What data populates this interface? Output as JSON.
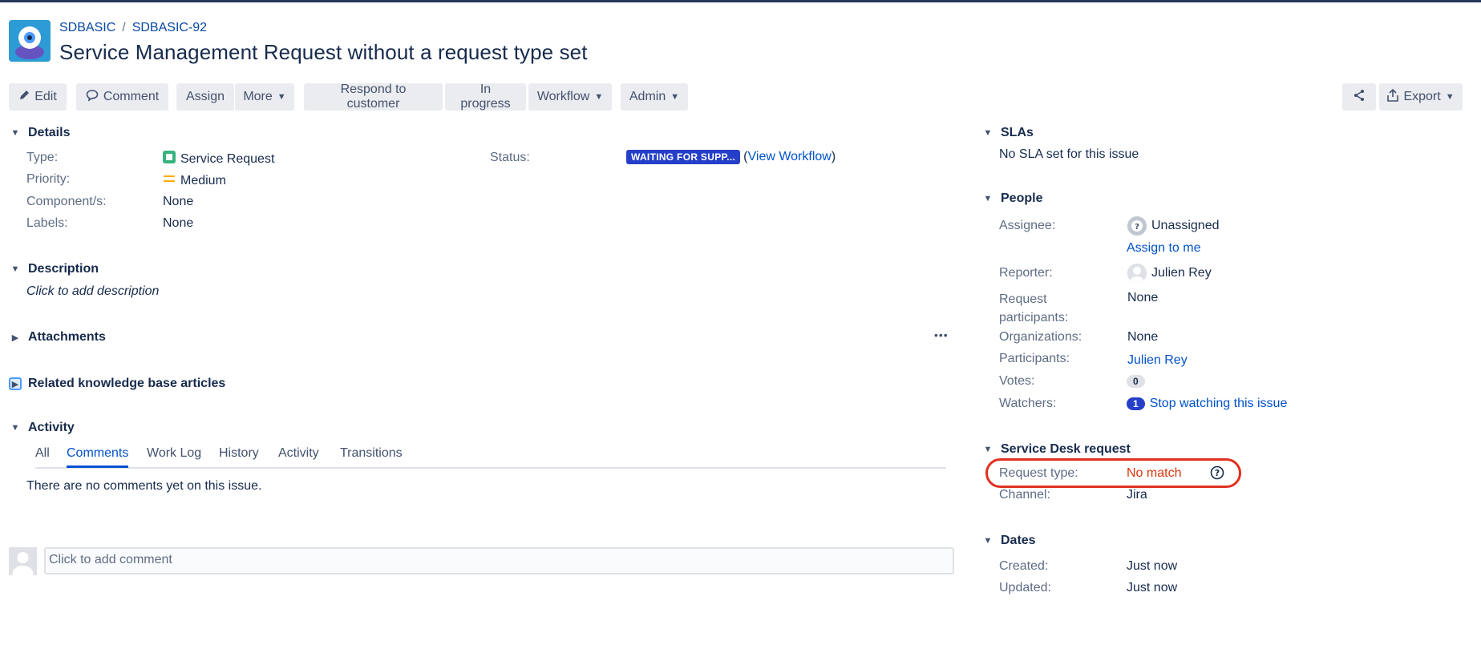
{
  "breadcrumb": {
    "project": "SDBASIC",
    "separator": "/",
    "issue_key": "SDBASIC-92"
  },
  "issue": {
    "title": "Service Management Request without a request type set"
  },
  "toolbar": {
    "edit": "Edit",
    "comment": "Comment",
    "assign": "Assign",
    "more": "More",
    "respond": "Respond to customer",
    "in_progress": "In progress",
    "workflow": "Workflow",
    "admin": "Admin",
    "export": "Export"
  },
  "details": {
    "heading": "Details",
    "type_label": "Type:",
    "type_value": "Service Request",
    "priority_label": "Priority:",
    "priority_value": "Medium",
    "components_label": "Component/s:",
    "components_value": "None",
    "labels_label": "Labels:",
    "labels_value": "None",
    "status_label": "Status:",
    "status_value": "WAITING FOR SUPP...",
    "view_workflow_open": "(",
    "view_workflow": "View Workflow",
    "view_workflow_close": ")"
  },
  "description": {
    "heading": "Description",
    "placeholder": "Click to add description"
  },
  "attachments": {
    "heading": "Attachments",
    "menu": "•••"
  },
  "kb": {
    "heading": "Related knowledge base articles"
  },
  "activity": {
    "heading": "Activity",
    "tabs": [
      "All",
      "Comments",
      "Work Log",
      "History",
      "Activity",
      "Transitions"
    ],
    "empty": "There are no comments yet on this issue.",
    "comment_placeholder": "Click to add comment"
  },
  "slas": {
    "heading": "SLAs",
    "empty": "No SLA set for this issue"
  },
  "people": {
    "heading": "People",
    "assignee_label": "Assignee:",
    "assignee_value": "Unassigned",
    "assign_to_me": "Assign to me",
    "reporter_label": "Reporter:",
    "reporter_value": "Julien Rey",
    "request_participants_label_1": "Request",
    "request_participants_label_2": "participants:",
    "request_participants_value": "None",
    "organizations_label": "Organizations:",
    "organizations_value": "None",
    "participants_label": "Participants:",
    "participants_value": "Julien Rey",
    "votes_label": "Votes:",
    "votes_value": "0",
    "watchers_label": "Watchers:",
    "watchers_count": "1",
    "watchers_action": "Stop watching this issue"
  },
  "service_desk": {
    "heading": "Service Desk request",
    "request_type_label": "Request type:",
    "request_type_value": "No match",
    "channel_label": "Channel:",
    "channel_value": "Jira"
  },
  "dates": {
    "heading": "Dates",
    "created_label": "Created:",
    "created_value": "Just now",
    "updated_label": "Updated:",
    "updated_value": "Just now"
  },
  "colors": {
    "link": "#0052cc",
    "status_lozenge": "#253fc8",
    "alert_red": "#de350b",
    "type_icon_green": "#36b37e",
    "priority_orange": "#ffab00"
  },
  "icons": [
    "pencil-icon",
    "comment-icon",
    "share-icon",
    "export-icon",
    "help-icon",
    "chevron-down-icon",
    "more-icon",
    "service-request-icon",
    "priority-medium-icon"
  ]
}
